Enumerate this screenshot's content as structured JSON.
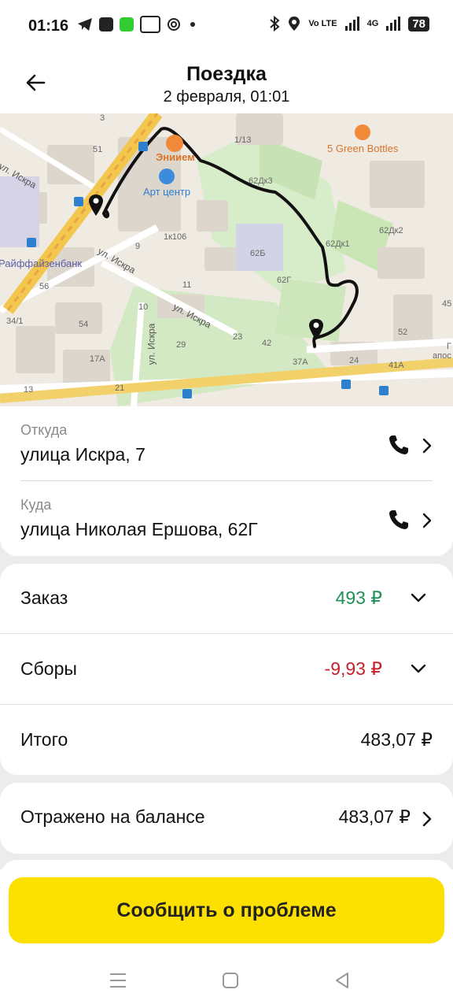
{
  "status_bar": {
    "time": "01:16",
    "network": "Vo LTE",
    "network_2": "4G",
    "battery": "78"
  },
  "header": {
    "title": "Поездка",
    "subtitle": "2 февраля, 01:01"
  },
  "map": {
    "labels": {
      "enim": "Эниием",
      "art_center": "Арт центр",
      "green_bottles": "5 Green Bottles",
      "raiffeisen": "Райффайзенбанк",
      "street_iskra_1": "ул. Искра",
      "street_iskra_2": "ул. Искра",
      "street_iskra_3": "ул. Искра",
      "street_iskra_4": "ул. Искра",
      "house_3": "3",
      "house_51": "51",
      "house_1_13": "1/13",
      "house_62dk3": "62Дк3",
      "house_62dk2": "62Дк2",
      "house_62dk1": "62Дк1",
      "house_1k106": "1к106",
      "house_9": "9",
      "house_62b": "62Б",
      "house_62g": "62Г",
      "house_56": "56",
      "house_11": "11",
      "house_34_1": "34/1",
      "house_54": "54",
      "house_10": "10",
      "house_23": "23",
      "house_42": "42",
      "house_52": "52",
      "house_29": "29",
      "house_17a": "17А",
      "house_37a": "37А",
      "house_24": "24",
      "house_41a": "41А",
      "house_13": "13",
      "house_21": "21",
      "house_45": "45",
      "edge_apos": "апос",
      "edge_g": "Г"
    }
  },
  "from": {
    "label": "Откуда",
    "value": "улица Искра, 7"
  },
  "to": {
    "label": "Куда",
    "value": "улица Николая Ершова, 62Г"
  },
  "order": {
    "label": "Заказ",
    "value": "493 ₽"
  },
  "fees": {
    "label": "Сборы",
    "value": "-9,93 ₽"
  },
  "total": {
    "label": "Итого",
    "value": "483,07 ₽"
  },
  "balance": {
    "label": "Отражено на балансе",
    "value": "483,07 ₽"
  },
  "report_button": "Сообщить о проблеме",
  "colors": {
    "accent": "#fce000",
    "positive": "#1e9154",
    "negative": "#c8202b"
  }
}
